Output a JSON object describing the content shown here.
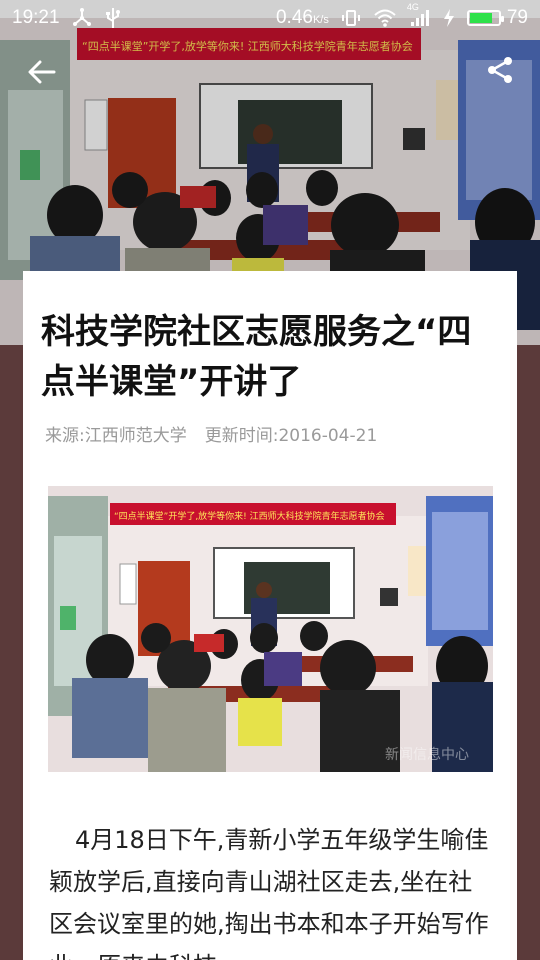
{
  "status_bar": {
    "time": "19:21",
    "network_speed": "0.46",
    "network_speed_unit": "K/s",
    "signal_type": "4G",
    "battery_percent": "79",
    "battery_level": 0.79,
    "icons": [
      "usb-tether-icon",
      "usb-icon",
      "vibrate-icon",
      "wifi-icon",
      "signal-icon",
      "charging-icon",
      "battery-icon"
    ]
  },
  "nav": {
    "back_icon": "arrow-left-icon",
    "share_icon": "share-icon"
  },
  "hero": {
    "banner_text": "“四点半课堂”开学了,放学等你来! 江西师大科技学院青年志愿者协会"
  },
  "article": {
    "title": "科技学院社区志愿服务之“四点半课堂”开讲了",
    "source": "来源:江西师范大学",
    "updated": "更新时间:2016-04-21",
    "photo_banner": "“四点半课堂”开学了,放学等你来! 江西师大科技学院青年志愿者协会",
    "photo_watermark": "新闻信息中心",
    "body": "4月18日下午,青新小学五年级学生喻佳颖放学后,直接向青山湖社区走去,坐在社区会议室里的她,掏出书本和本子开始写作业。原来由科技"
  },
  "colors": {
    "background": "#5b3a3a",
    "banner_red": "#c8102e",
    "battery_green": "#2ee14a"
  }
}
